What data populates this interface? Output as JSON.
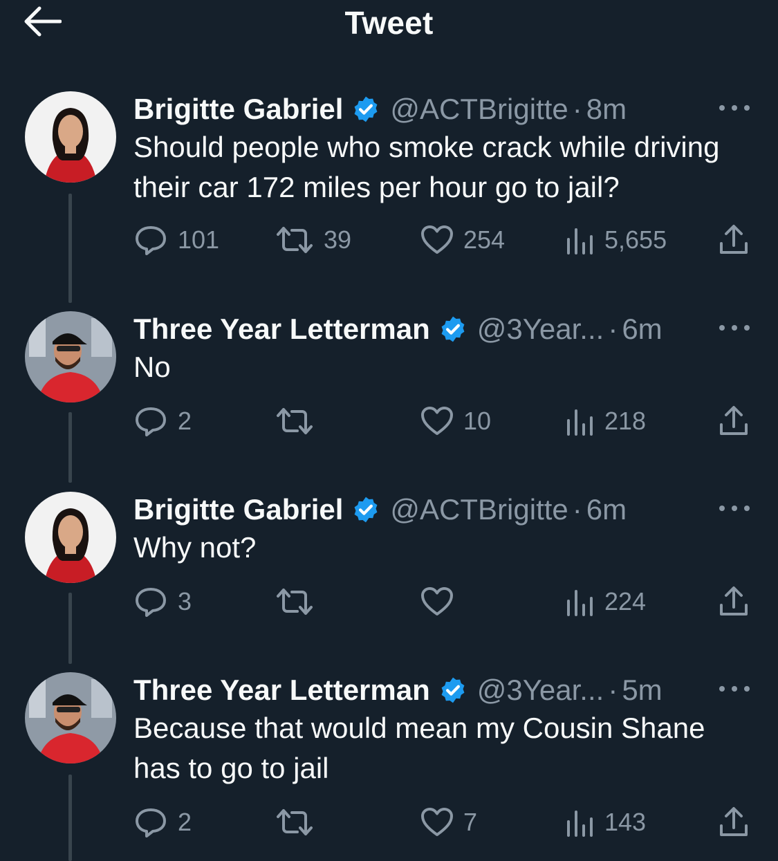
{
  "header": {
    "title": "Tweet"
  },
  "tweets": [
    {
      "name": "Brigitte Gabriel",
      "handle": "@ACTBrigitte",
      "time": "8m",
      "text": "Should people who smoke crack while driving their car 172 miles per hour go to jail?",
      "replies": "101",
      "retweets": "39",
      "likes": "254",
      "views": "5,655"
    },
    {
      "name": "Three Year Letterman",
      "handle": "@3Year...",
      "time": "6m",
      "text": "No",
      "replies": "2",
      "retweets": "",
      "likes": "10",
      "views": "218"
    },
    {
      "name": "Brigitte Gabriel",
      "handle": "@ACTBrigitte",
      "time": "6m",
      "text": "Why not?",
      "replies": "3",
      "retweets": "",
      "likes": "",
      "views": "224"
    },
    {
      "name": "Three Year Letterman",
      "handle": "@3Year...",
      "time": "5m",
      "text": "Because that would mean my Cousin Shane has to go to jail",
      "replies": "2",
      "retweets": "",
      "likes": "7",
      "views": "143"
    }
  ],
  "meta": {
    "separator": "·"
  },
  "icons": {
    "back": "arrow-left-icon",
    "verified": "verified-badge-icon",
    "more": "more-icon",
    "reply": "reply-icon",
    "retweet": "retweet-icon",
    "like": "heart-icon",
    "views": "views-icon",
    "share": "share-icon"
  },
  "colors": {
    "background": "#15202b",
    "text": "#f7f9f9",
    "secondary": "#8b98a5",
    "verified": "#1d9bf0",
    "thread_line": "#38444d"
  }
}
